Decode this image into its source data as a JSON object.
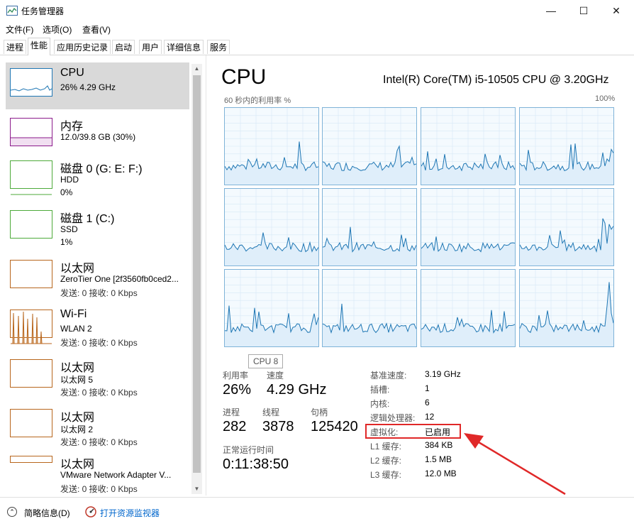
{
  "window": {
    "title": "任务管理器",
    "minimize_icon": "minimize-icon",
    "maximize_icon": "maximize-icon",
    "close_icon": "close-icon"
  },
  "menu": {
    "file": "文件(F)",
    "options": "选项(O)",
    "view": "查看(V)"
  },
  "tabs": [
    "进程",
    "性能",
    "应用历史记录",
    "启动",
    "用户",
    "详细信息",
    "服务"
  ],
  "active_tab": "性能",
  "resources": [
    {
      "name": "CPU",
      "sub1": "26% 4.29 GHz",
      "sub2": "",
      "color": "#1f77b4"
    },
    {
      "name": "内存",
      "sub1": "12.0/39.8 GB (30%)",
      "sub2": "",
      "color": "#8b1a8b"
    },
    {
      "name": "磁盘 0 (G: E: F:)",
      "sub1": "HDD",
      "sub2": "0%",
      "color": "#4daa3a"
    },
    {
      "name": "磁盘 1 (C:)",
      "sub1": "SSD",
      "sub2": "1%",
      "color": "#4daa3a"
    },
    {
      "name": "以太网",
      "sub1": "ZeroTier One [2f3560fb0ced2...",
      "sub2": "发送: 0 接收: 0 Kbps",
      "color": "#b8661d"
    },
    {
      "name": "Wi-Fi",
      "sub1": "WLAN 2",
      "sub2": "发送: 0 接收: 0 Kbps",
      "color": "#b8661d"
    },
    {
      "name": "以太网",
      "sub1": "以太网 5",
      "sub2": "发送: 0 接收: 0 Kbps",
      "color": "#b8661d"
    },
    {
      "name": "以太网",
      "sub1": "以太网 2",
      "sub2": "发送: 0 接收: 0 Kbps",
      "color": "#b8661d"
    },
    {
      "name": "以太网",
      "sub1": "VMware Network Adapter V...",
      "sub2": "发送: 0 接收: 0 Kbps",
      "color": "#b8661d"
    }
  ],
  "cpu": {
    "title": "CPU",
    "model": "Intel(R) Core(TM) i5-10505 CPU @ 3.20GHz",
    "graph_label": "60 秒内的利用率 %",
    "graph_max": "100%",
    "tooltip": "CPU 8",
    "utilization_label": "利用率",
    "utilization_value": "26%",
    "speed_label": "速度",
    "speed_value": "4.29 GHz",
    "processes_label": "进程",
    "processes_value": "282",
    "threads_label": "线程",
    "threads_value": "3878",
    "handles_label": "句柄",
    "handles_value": "125420",
    "uptime_label": "正常运行时间",
    "uptime_value": "0:11:38:50",
    "specs": [
      {
        "label": "基准速度:",
        "value": "3.19 GHz"
      },
      {
        "label": "插槽:",
        "value": "1"
      },
      {
        "label": "内核:",
        "value": "6"
      },
      {
        "label": "逻辑处理器:",
        "value": "12"
      },
      {
        "label": "虚拟化:",
        "value": "已启用"
      },
      {
        "label": "L1 缓存:",
        "value": "384 KB"
      },
      {
        "label": "L2 缓存:",
        "value": "1.5 MB"
      },
      {
        "label": "L3 缓存:",
        "value": "12.0 MB"
      }
    ]
  },
  "footer": {
    "brief": "简略信息(D)",
    "monitor": "打开资源监视器"
  },
  "colors": {
    "cpu_line": "#1f77b4",
    "cpu_fill": "#dfeefa",
    "highlight": "#e02828"
  }
}
